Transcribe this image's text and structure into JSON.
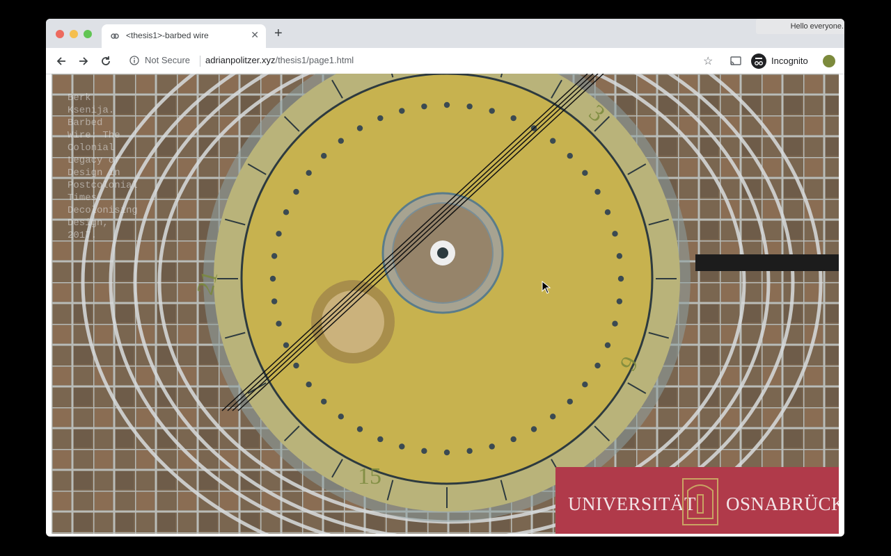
{
  "browser": {
    "tab": {
      "title": "<thesis1>-barbed wire",
      "close_icon": "close-icon"
    },
    "new_tab_label": "+",
    "notification": "Hello everyone.",
    "address_bar": {
      "security_label": "Not Secure",
      "url_domain": "adrianpolitzer.xyz",
      "url_path": "/thesis1/page1.html"
    },
    "incognito_label": "Incognito"
  },
  "page": {
    "overlay_text": "Berk\nKsenija.\nBarbed\nWire: The\nColonial\nLegacy of\nDesign in\nPostcolonial\nTimes.\nDecolonising\nDesign,\n2017.",
    "logo": {
      "left": "UNIVERSITÄT",
      "right": "OSNABRÜCK"
    }
  },
  "colors": {
    "logo_red": "#b03a4a",
    "dial_yellow": "#c7b24f",
    "tabbar_gray": "#dee1e6"
  }
}
